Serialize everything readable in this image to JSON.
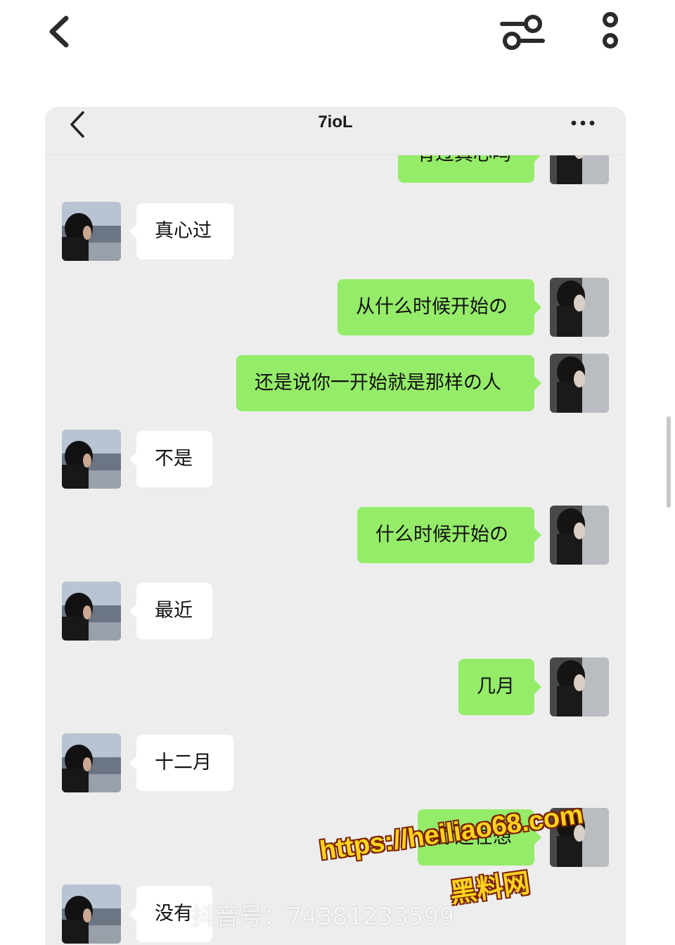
{
  "app_header": {
    "back_icon": "chevron-left-icon",
    "filter_icon": "sliders-icon",
    "more_icon": "vertical-dots-icon"
  },
  "chat": {
    "title": "7ioL",
    "back_icon": "chevron-left-icon",
    "more_icon": "horizontal-dots-icon",
    "messages": [
      {
        "side": "right",
        "text": "有过真心吗"
      },
      {
        "side": "left",
        "text": "真心过"
      },
      {
        "side": "right",
        "text": "从什么时候开始の"
      },
      {
        "side": "right",
        "text": "还是说你一开始就是那样の人"
      },
      {
        "side": "left",
        "text": "不是"
      },
      {
        "side": "right",
        "text": "什么时候开始の"
      },
      {
        "side": "left",
        "text": "最近"
      },
      {
        "side": "right",
        "text": "几月"
      },
      {
        "side": "left",
        "text": "十二月"
      },
      {
        "side": "right",
        "text": "你还在想"
      },
      {
        "side": "left",
        "text": "没有"
      }
    ],
    "colors": {
      "background": "#ededed",
      "sent_bubble": "#95ec69",
      "received_bubble": "#ffffff"
    }
  },
  "overlays": {
    "douyin_id": "抖音号：74381233599",
    "watermark_url": "https://heiliao68.com",
    "watermark_name": "黑料网"
  }
}
